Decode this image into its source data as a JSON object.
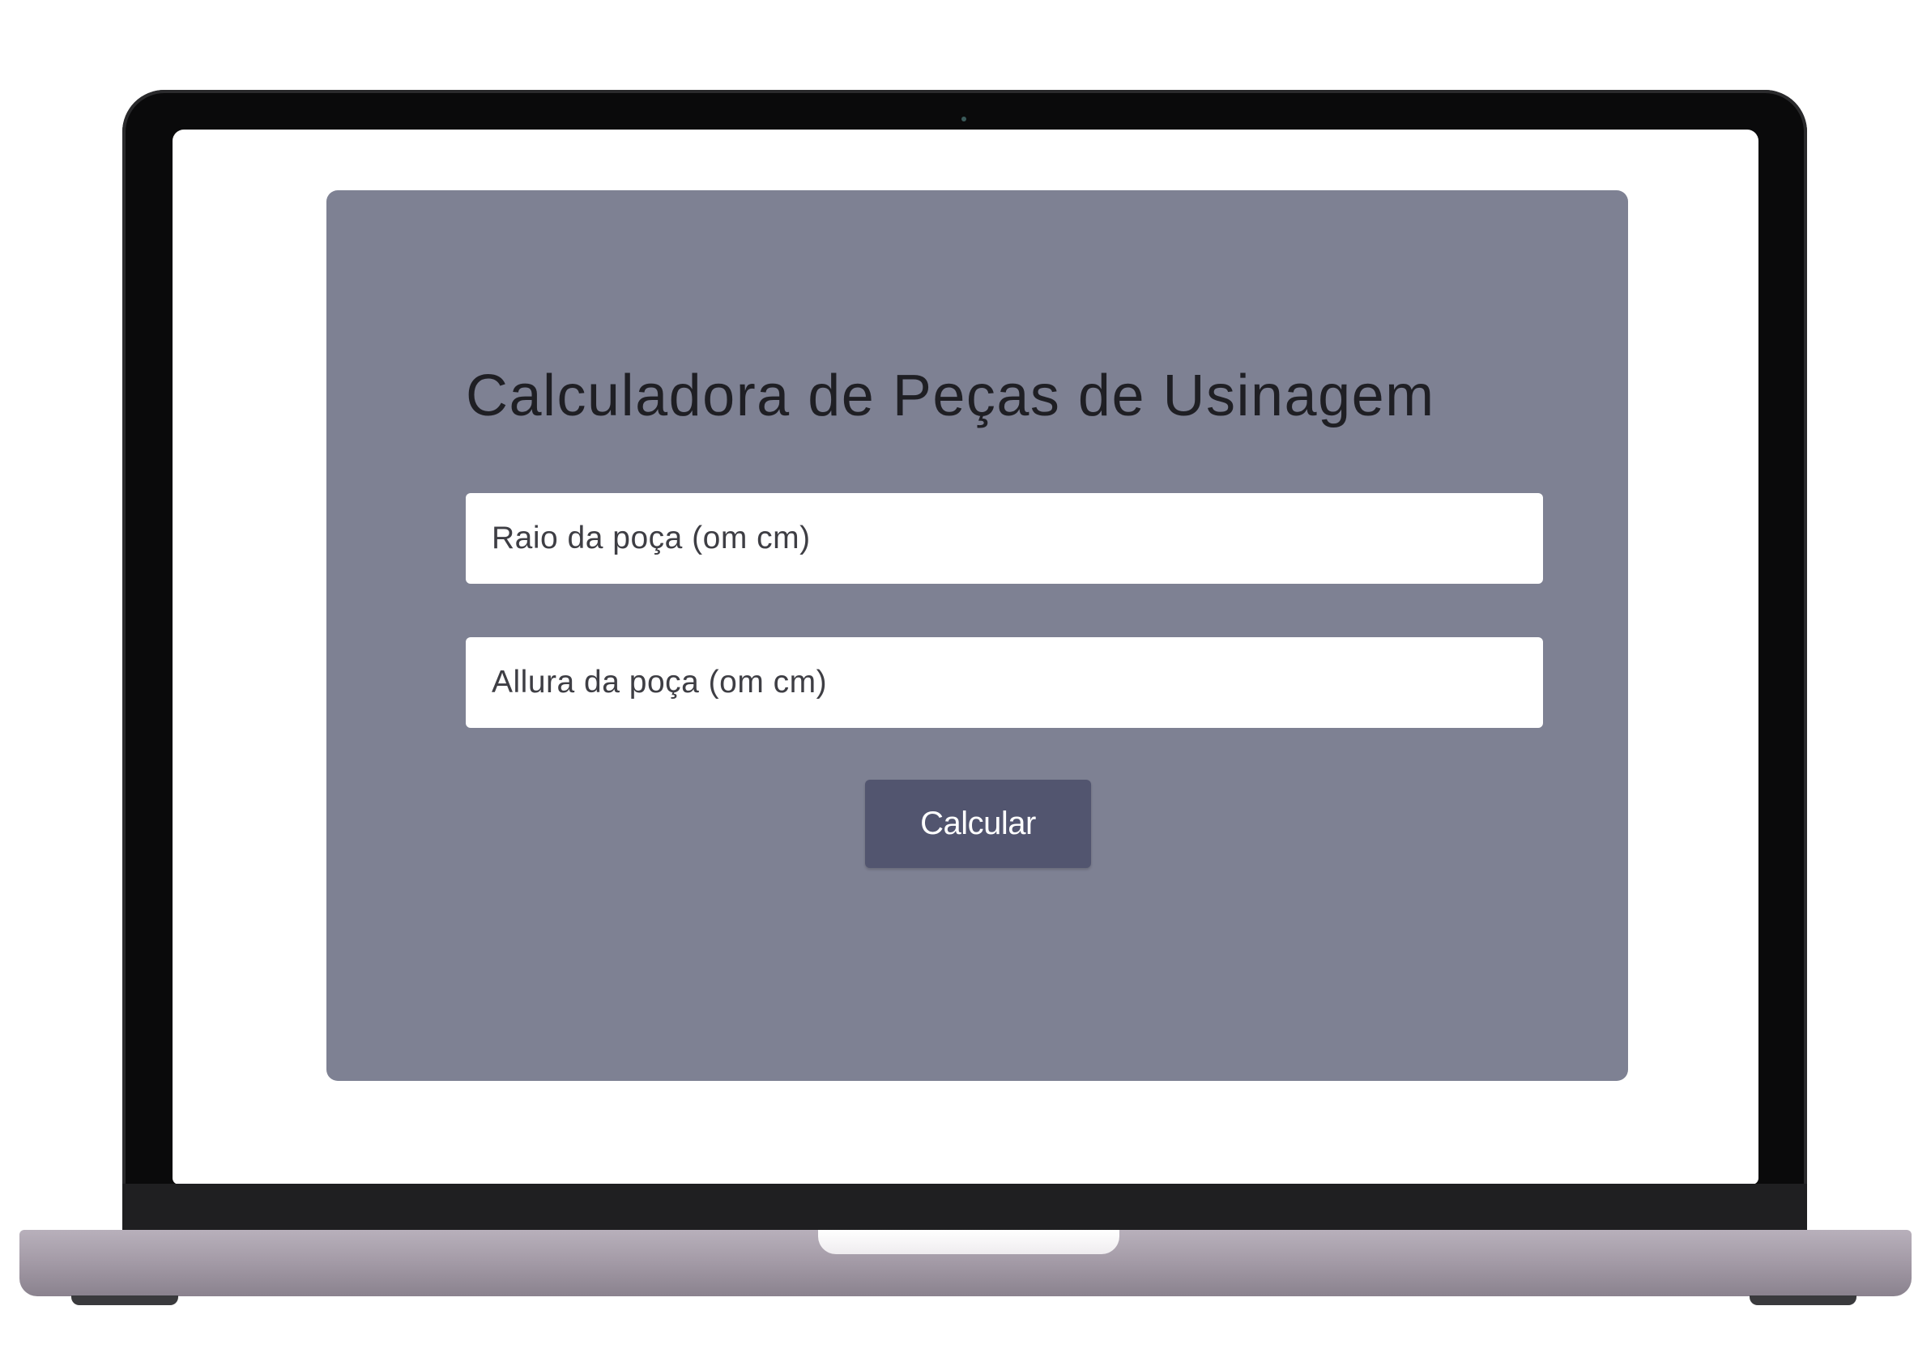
{
  "app": {
    "title": "Calculadora de Peças de Usinagem"
  },
  "form": {
    "raio": {
      "value": "",
      "placeholder": "Raio da poça (om cm)"
    },
    "altura": {
      "value": "",
      "placeholder": "Allura da poça (om cm)"
    },
    "submit_label": "Calcular"
  },
  "colors": {
    "card_background": "#7e8193",
    "button_background": "#52556f",
    "button_text": "#ffffff",
    "title_text": "#1f1f24",
    "input_background": "#ffffff"
  }
}
